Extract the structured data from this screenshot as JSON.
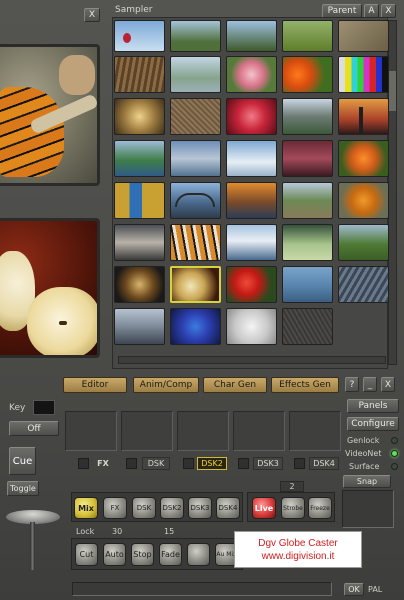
{
  "sampler": {
    "title": "Sampler",
    "parent_label": "Parent",
    "up_label": "A",
    "close_label": "X",
    "left_close_label": "X"
  },
  "tabs": [
    {
      "label": "Editor"
    },
    {
      "label": "Anim/Comp"
    },
    {
      "label": "Char Gen"
    },
    {
      "label": "Effects Gen"
    }
  ],
  "tab_controls": {
    "help": "?",
    "min": "_",
    "close": "X"
  },
  "key": {
    "label": "Key",
    "off_label": "Off",
    "cue_label": "Cue",
    "toggle_label": "Toggle"
  },
  "dsk_row": {
    "fx": "FX",
    "dsk": "DSK",
    "dsk2": "DSK2",
    "dsk3": "DSK3",
    "dsk4": "DSK4"
  },
  "side": {
    "panels": "Panels",
    "configure": "Configure",
    "genlock": "Genlock",
    "videonet": "VideoNet",
    "surface": "Surface",
    "snap": "Snap"
  },
  "buttons_row1": {
    "mix": "Mix",
    "fx": "FX",
    "dsk": "DSK",
    "dsk2": "DSK2",
    "dsk3": "DSK3",
    "dsk4": "DSK4"
  },
  "buttons_live": {
    "live": "Live",
    "strobe": "Strobe",
    "freeze": "Freeze",
    "count": "2"
  },
  "lock_row": {
    "lock": "Lock",
    "v1": "30",
    "v2": "15"
  },
  "buttons_row2": {
    "cut": "Cut",
    "auto": "Auto",
    "stop": "Stop",
    "fade": "Fade",
    "auto_mix": "Au Mix"
  },
  "footer": {
    "ok": "OK",
    "format": "PAL"
  },
  "watermark": {
    "line1": "Dgv Globe Caster",
    "line2": "www.digivision.it"
  },
  "leds": {
    "genlock": false,
    "videonet": true,
    "surface": false
  }
}
